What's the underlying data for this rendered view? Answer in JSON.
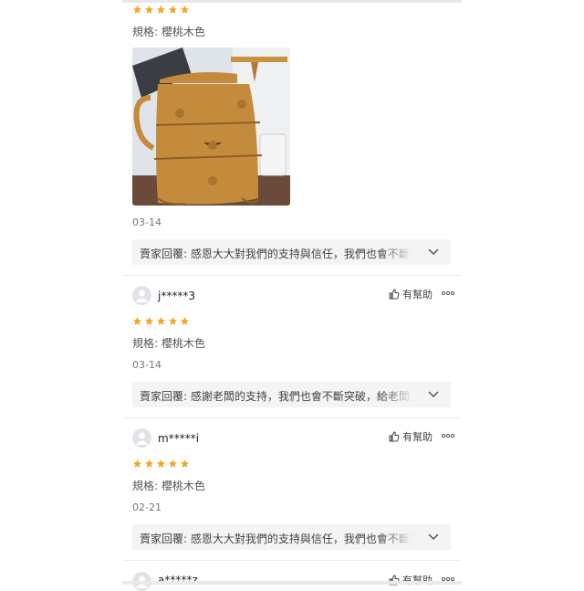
{
  "colors": {
    "star": "#f5a623",
    "reply_bg": "#f4f4f4",
    "avatar_bg": "#dfe3e8"
  },
  "review_top": {
    "rating": 5,
    "spec": "規格: 櫻桃木色",
    "photo": "cherry-wood-drawer-cabinet-photo",
    "date": "03-14",
    "reply": "賣家回覆: 感恩大大對我們的支持與信任，我們也會不斷努力"
  },
  "reviews": [
    {
      "username": "j*****3",
      "helpful_label": "有幫助",
      "rating": 5,
      "spec": "規格: 櫻桃木色",
      "date": "03-14",
      "reply": "賣家回覆: 感謝老闆的支持，我們也會不斷突破，給老闆"
    },
    {
      "username": "m*****i",
      "helpful_label": "有幫助",
      "rating": 5,
      "spec": "規格: 櫻桃木色",
      "date": "02-21",
      "reply": "賣家回覆: 感恩大大對我們的支持與信任，我們也會不斷努力"
    },
    {
      "username": "a*****z",
      "helpful_label": "有幫助"
    }
  ],
  "icons": {
    "thumb": "thumbs-up-icon",
    "more": "more-dots-icon",
    "chevron": "chevron-down-icon",
    "avatar": "avatar-icon"
  }
}
